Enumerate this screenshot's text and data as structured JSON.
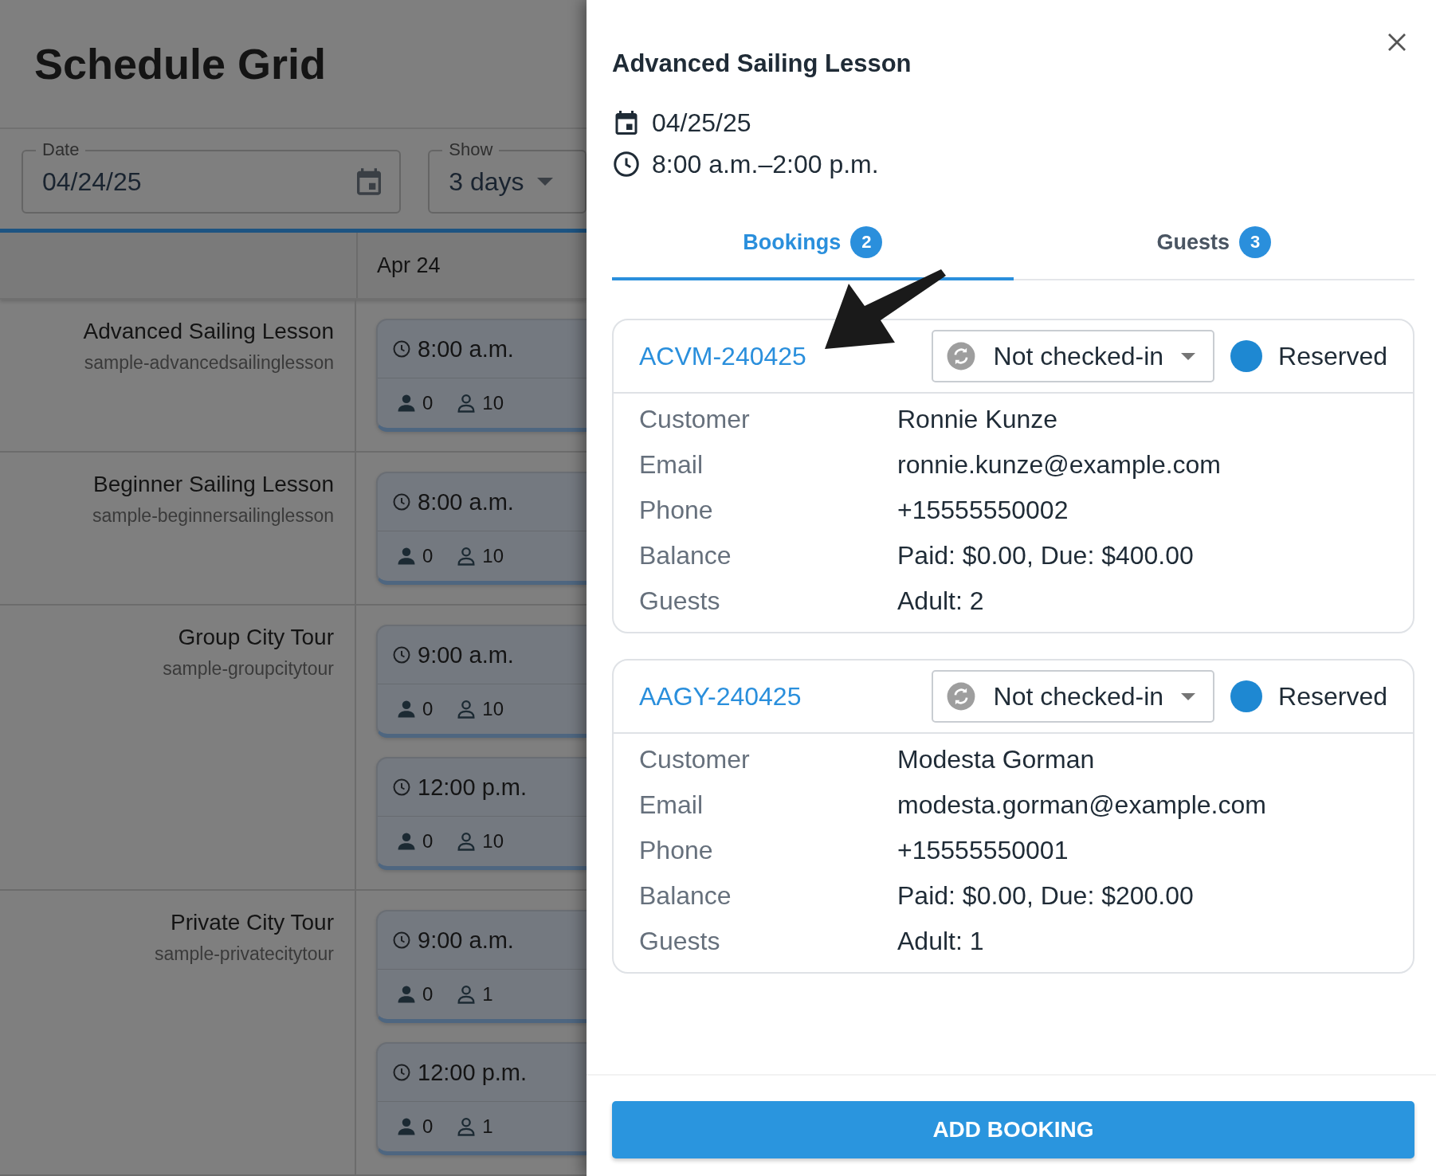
{
  "page": {
    "title": "Schedule Grid"
  },
  "filters": {
    "date": {
      "label": "Date",
      "value": "04/24/25"
    },
    "show": {
      "label": "Show",
      "value": "3 days"
    }
  },
  "grid": {
    "columns": [
      "Apr 24"
    ],
    "rows": [
      {
        "name": "Advanced Sailing Lesson",
        "code": "sample-advancedsailinglesson",
        "slots": [
          {
            "time": "8:00 a.m.",
            "booked": "0",
            "capacity": "10"
          }
        ]
      },
      {
        "name": "Beginner Sailing Lesson",
        "code": "sample-beginnersailinglesson",
        "slots": [
          {
            "time": "8:00 a.m.",
            "booked": "0",
            "capacity": "10"
          }
        ]
      },
      {
        "name": "Group City Tour",
        "code": "sample-groupcitytour",
        "slots": [
          {
            "time": "9:00 a.m.",
            "booked": "0",
            "capacity": "10"
          },
          {
            "time": "12:00 p.m.",
            "booked": "0",
            "capacity": "10"
          }
        ]
      },
      {
        "name": "Private City Tour",
        "code": "sample-privatecitytour",
        "slots": [
          {
            "time": "9:00 a.m.",
            "booked": "0",
            "capacity": "1"
          },
          {
            "time": "12:00 p.m.",
            "booked": "0",
            "capacity": "1"
          }
        ]
      }
    ]
  },
  "drawer": {
    "title": "Advanced Sailing Lesson",
    "date": "04/25/25",
    "time": "8:00 a.m.–2:00 p.m.",
    "tabs": [
      {
        "label": "Bookings",
        "count": "2",
        "selected": true
      },
      {
        "label": "Guests",
        "count": "3",
        "selected": false
      }
    ],
    "bookings": [
      {
        "code": "ACVM-240425",
        "checkin": "Not checked-in",
        "status": "Reserved",
        "color": "#1e88d2",
        "fields": [
          {
            "label": "Customer",
            "value": "Ronnie Kunze"
          },
          {
            "label": "Email",
            "value": "ronnie.kunze@example.com"
          },
          {
            "label": "Phone",
            "value": "+15555550002"
          },
          {
            "label": "Balance",
            "value": "Paid: $0.00, Due: $400.00"
          },
          {
            "label": "Guests",
            "value": "Adult: 2"
          }
        ]
      },
      {
        "code": "AAGY-240425",
        "checkin": "Not checked-in",
        "status": "Reserved",
        "color": "#1e88d2",
        "fields": [
          {
            "label": "Customer",
            "value": "Modesta Gorman"
          },
          {
            "label": "Email",
            "value": "modesta.gorman@example.com"
          },
          {
            "label": "Phone",
            "value": "+15555550001"
          },
          {
            "label": "Balance",
            "value": "Paid: $0.00, Due: $200.00"
          },
          {
            "label": "Guests",
            "value": "Adult: 1"
          }
        ]
      }
    ],
    "button": "ADD BOOKING"
  }
}
